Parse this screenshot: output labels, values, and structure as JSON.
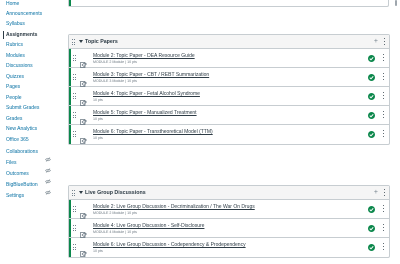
{
  "nav": {
    "items": [
      {
        "label": "Home",
        "hidden": false
      },
      {
        "label": "Announcements",
        "hidden": false
      },
      {
        "label": "Syllabus",
        "hidden": false
      },
      {
        "label": "Assignments",
        "hidden": false,
        "active": true
      },
      {
        "label": "Rubrics",
        "hidden": false
      },
      {
        "label": "Modules",
        "hidden": false
      },
      {
        "label": "Discussions",
        "hidden": false
      },
      {
        "label": "Quizzes",
        "hidden": false
      },
      {
        "label": "Pages",
        "hidden": false
      },
      {
        "label": "People",
        "hidden": false
      },
      {
        "label": "Submit Grades",
        "hidden": false
      },
      {
        "label": "Grades",
        "hidden": false
      },
      {
        "label": "New Analytics",
        "hidden": false
      },
      {
        "label": "Office 365",
        "hidden": false
      },
      {
        "label": "Collaborations",
        "hidden": true
      },
      {
        "label": "Files",
        "hidden": true
      },
      {
        "label": "Outcomes",
        "hidden": true
      },
      {
        "label": "BigBlueButton",
        "hidden": true
      },
      {
        "label": "Settings",
        "hidden": false
      }
    ]
  },
  "modules": [
    {
      "title": "Topic Papers",
      "items": [
        {
          "title": "Module 2: Topic Paper - DEA Resource Guide",
          "meta": "MODULE 2 Module  |  10 pts"
        },
        {
          "title": "Module 3: Topic Paper - CBT / REBT Summarization",
          "meta": "MODULE 3 Module  |  10 pts"
        },
        {
          "title": "Module 4: Topic Paper - Fetal Alcohol Syndrome",
          "meta": "10 pts"
        },
        {
          "title": "Module 5: Topic Paper - Manualized Treatment",
          "meta": "10 pts"
        },
        {
          "title": "Module 6: Topic Paper - Transtheoretical Model (TTM)",
          "meta": "10 pts"
        }
      ]
    },
    {
      "title": "Live Group Discussions",
      "items": [
        {
          "title": "Module 2: Live Group Discussion - Decriminalization / The War On Drugs",
          "meta": "MODULE 2 Module  |  10 pts"
        },
        {
          "title": "Module 4: Live Group Discussion - Self-Disclosure",
          "meta": "MODULE 4 Module  |  10 pts"
        },
        {
          "title": "Module 6: Live Group Discussion - Codependency & Prodependency",
          "meta": "10 pts"
        }
      ]
    }
  ],
  "colors": {
    "published": "#0b874b",
    "link": "#0770a3"
  },
  "icons": {
    "add": "+",
    "publish": "check-circle-icon",
    "item_type": "assignment-icon"
  }
}
